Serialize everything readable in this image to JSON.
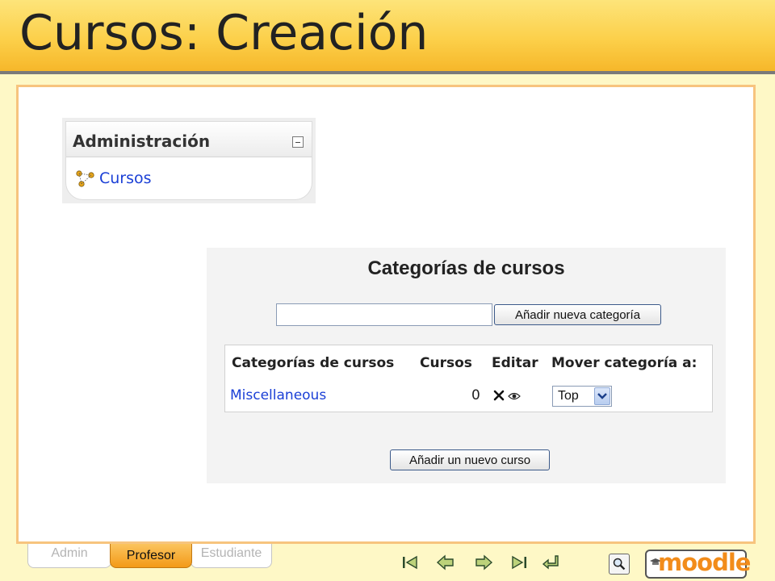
{
  "slide": {
    "title": "Cursos: Creación"
  },
  "admin_block": {
    "title": "Administración",
    "items": [
      {
        "label": "Cursos",
        "icon": "course-icon"
      }
    ]
  },
  "categories": {
    "heading": "Categorías de cursos",
    "new_category_input": {
      "value": "",
      "placeholder": ""
    },
    "add_category_button": "Añadir nueva categoría",
    "table": {
      "headers": [
        "Categorías de cursos",
        "Cursos",
        "Editar",
        "Mover categoría a:"
      ],
      "rows": [
        {
          "name": "Miscellaneous",
          "courses": "0",
          "edit_icons": [
            "delete-icon",
            "eye-icon"
          ],
          "move_to": "Top"
        }
      ]
    },
    "add_course_button": "Añadir un nuevo curso"
  },
  "roles": {
    "tabs": [
      "Admin",
      "Profesor",
      "Estudiante"
    ],
    "active": "Profesor"
  },
  "navigation": {
    "icons": [
      "first-slide-icon",
      "previous-slide-icon",
      "next-slide-icon",
      "last-slide-icon",
      "return-icon",
      "search-icon"
    ]
  },
  "logo": {
    "text": "moodle"
  },
  "colors": {
    "title_bar": "#fcd04a",
    "background": "#fef8c6",
    "panel_border": "#f7c47e",
    "link": "#1a3fd6",
    "active_tab": "#f39a18",
    "logo": "#f28c1a"
  }
}
